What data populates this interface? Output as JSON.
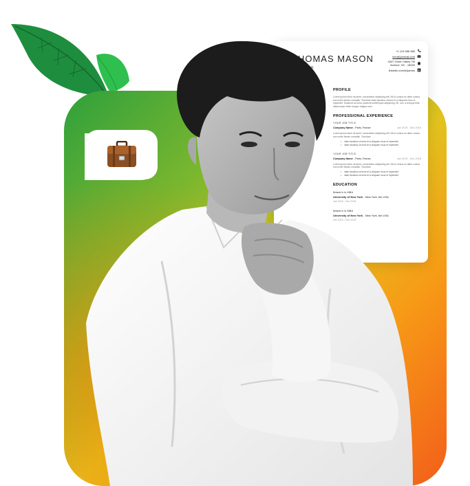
{
  "resume": {
    "name": "THOMAS MASON",
    "role": "DIRECTOR",
    "contacts": {
      "phone": "+1 124 556 980",
      "email": "info@ycemail.com",
      "address": "4347 Green Valley 7th Avenue, NY - 18020",
      "linkedin": "linkedin.com/in/james"
    },
    "sections": {
      "profile": {
        "title": "PROFILE",
        "text": "Lorem ipsum dolor sit amet, consectetur adipiscing elit. Nil ut cursus eu diam cursus eus morbi fames convallis. Tincidunt vitae faucibus viverra et ut aliquam risus et imperdiet. Euismod ac tortor placerat scelerisque adipiscing. Mi, non, a tempus felis, ullamcorper vitae congue magna sem."
      },
      "experience": {
        "title": "PROFESSIONAL EXPERIENCE",
        "jobs": [
          {
            "title": "YOUR JOB TITLE",
            "company": "Company Name",
            "location": " - Paris, France",
            "dates": "Jan 2015 - Dec 2018",
            "text": "Lorem ipsum dolor sit amet, consectetur adipiscing elit. Nil ut cursus eu diam cursus eus morbi fames convallis. Tincidunt",
            "bullets": [
              "vitae faucibus viverra et ut aliquam risus et imperdiet",
              "vitae faucibus viverra et ut aliquam risus et imperdiet"
            ]
          },
          {
            "title": "YOUR JOB TITLE",
            "company": "Company Name",
            "location": " - Paris, France",
            "dates": "Jan 2015 - Dec 2018",
            "text": "Lorem ipsum dolor sit amet, consectetur adipiscing elit. Nil ut cursus eu diam cursus eus morbi fames convallis. Tincidunt",
            "bullets": [
              "vitae faucibus viverra et ut aliquam risus et imperdiet",
              "vitae faucibus viverra et ut aliquam risus et imperdiet"
            ]
          }
        ]
      },
      "education": {
        "title": "EDUCATION",
        "items": [
          {
            "degree": "Master's in MBA",
            "school": "University of New York",
            "location": " - New York, the USA",
            "dates": "Jan 2015 - Dec 2018"
          },
          {
            "degree": "Master's in MBA",
            "school": "University of New York",
            "location": " - New York, the USA",
            "dates": "Jan 2015 - Dec 2018"
          }
        ]
      }
    }
  },
  "icons": {
    "badge": "briefcase-icon",
    "phone": "phone-icon",
    "email": "envelope-icon",
    "address": "home-icon",
    "linkedin": "linkedin-icon"
  },
  "colors": {
    "gradient": [
      "#2ea03c",
      "#7cb72e",
      "#e2c21e",
      "#f79a16",
      "#f25e1a"
    ],
    "leaf_dark": "#1f8a3c",
    "leaf_light": "#2fbf4f"
  }
}
